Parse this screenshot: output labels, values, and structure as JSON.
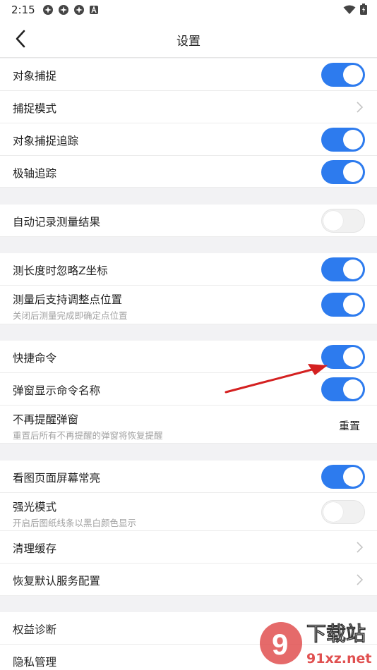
{
  "status": {
    "time": "2:15",
    "left_icons": [
      "app-icon",
      "app-icon",
      "app-icon",
      "accessibility-icon"
    ],
    "right_icons": [
      "wifi-icon",
      "battery-icon"
    ]
  },
  "header": {
    "title": "设置",
    "back_icon": "back-arrow-icon"
  },
  "settings": {
    "snap": {
      "label": "对象捕捉",
      "on": true
    },
    "snap_mode": {
      "label": "捕捉模式"
    },
    "snap_track": {
      "label": "对象捕捉追踪",
      "on": true
    },
    "polar": {
      "label": "极轴追踪",
      "on": true
    },
    "auto_record": {
      "label": "自动记录测量结果",
      "on": false
    },
    "ignore_z": {
      "label": "测长度时忽略Z坐标",
      "on": true
    },
    "adjust_point": {
      "label": "测量后支持调整点位置",
      "sub": "关闭后测量完成即确定点位置",
      "on": true
    },
    "shortcut": {
      "label": "快捷命令",
      "on": true
    },
    "popup_name": {
      "label": "弹窗显示命令名称",
      "on": true
    },
    "no_remind": {
      "label": "不再提醒弹窗",
      "sub": "重置后所有不再提醒的弹窗将恢复提醒",
      "action": "重置"
    },
    "screen_on": {
      "label": "看图页面屏幕常亮",
      "on": true
    },
    "strong_light": {
      "label": "强光模式",
      "sub": "开启后图纸线条以黑白颜色显示",
      "on": false
    },
    "clear_cache": {
      "label": "清理缓存"
    },
    "restore_default": {
      "label": "恢复默认服务配置"
    },
    "rights_diag": {
      "label": "权益诊断"
    },
    "privacy": {
      "label": "隐私管理"
    }
  },
  "colors": {
    "accent": "#2d7bee",
    "toggle_off": "#f1f1f1",
    "background": "#f2f2f4",
    "annotation_arrow": "#d42020"
  },
  "watermark": {
    "number": "9",
    "text": "下载站",
    "url": "91xz.net"
  }
}
